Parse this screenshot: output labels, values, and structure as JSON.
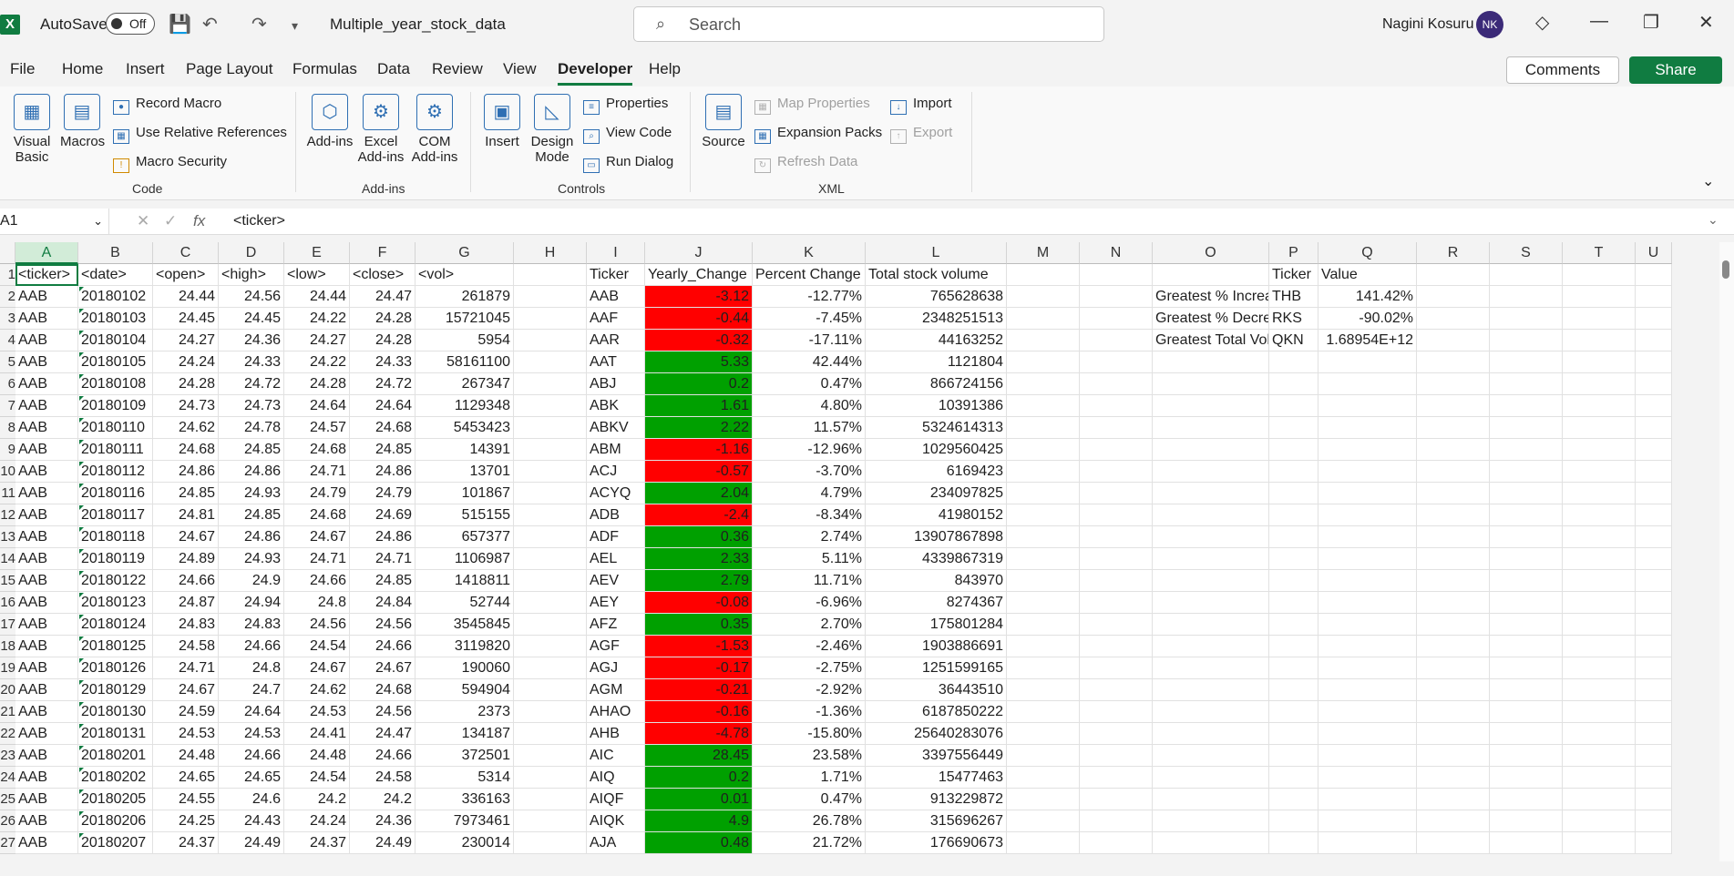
{
  "app": {
    "autosave_label": "AutoSave",
    "autosave_state": "Off",
    "file_title": "Multiple_year_stock_data",
    "search_placeholder": "Search",
    "user_name": "Nagini Kosuru",
    "user_initials": "NK"
  },
  "menu": [
    "File",
    "Home",
    "Insert",
    "Page Layout",
    "Formulas",
    "Data",
    "Review",
    "View",
    "Developer",
    "Help"
  ],
  "menu_active": "Developer",
  "actions": {
    "comments": "Comments",
    "share": "Share"
  },
  "ribbon": {
    "code": {
      "visual_basic": "Visual Basic",
      "macros": "Macros",
      "record_macro": "Record Macro",
      "use_relative": "Use Relative References",
      "macro_security": "Macro Security",
      "group": "Code"
    },
    "addins": {
      "add_ins": "Add-ins",
      "excel_add_ins": "Excel Add-ins",
      "com_add_ins": "COM Add-ins",
      "group": "Add-ins"
    },
    "controls": {
      "insert": "Insert",
      "design_mode": "Design Mode",
      "properties": "Properties",
      "view_code": "View Code",
      "run_dialog": "Run Dialog",
      "group": "Controls"
    },
    "xml": {
      "source": "Source",
      "map_properties": "Map Properties",
      "expansion_packs": "Expansion Packs",
      "refresh_data": "Refresh Data",
      "import": "Import",
      "export": "Export",
      "group": "XML"
    }
  },
  "formula_bar": {
    "name_box": "A1",
    "value": "<ticker>"
  },
  "columns": [
    "A",
    "B",
    "C",
    "D",
    "E",
    "F",
    "G",
    "H",
    "I",
    "J",
    "K",
    "L",
    "M",
    "N",
    "O",
    "P",
    "Q",
    "R",
    "S",
    "T",
    "U"
  ],
  "rows": [
    "1",
    "2",
    "3",
    "4",
    "5",
    "6",
    "7",
    "8",
    "9",
    "10",
    "11",
    "12",
    "13",
    "14",
    "15",
    "16",
    "17",
    "18",
    "19",
    "20",
    "21",
    "22",
    "23",
    "24",
    "25",
    "26",
    "27"
  ],
  "header_row": [
    "<ticker>",
    "<date>",
    "<open>",
    "<high>",
    "<low>",
    "<close>",
    "<vol>",
    "",
    "Ticker",
    "Yearly_Change",
    "Percent Change",
    "Total  stock volume"
  ],
  "stock_rows": [
    [
      "AAB",
      "20180102",
      "24.44",
      "24.56",
      "24.44",
      "24.47",
      "261879"
    ],
    [
      "AAB",
      "20180103",
      "24.45",
      "24.45",
      "24.22",
      "24.28",
      "15721045"
    ],
    [
      "AAB",
      "20180104",
      "24.27",
      "24.36",
      "24.27",
      "24.28",
      "5954"
    ],
    [
      "AAB",
      "20180105",
      "24.24",
      "24.33",
      "24.22",
      "24.33",
      "58161100"
    ],
    [
      "AAB",
      "20180108",
      "24.28",
      "24.72",
      "24.28",
      "24.72",
      "267347"
    ],
    [
      "AAB",
      "20180109",
      "24.73",
      "24.73",
      "24.64",
      "24.64",
      "1129348"
    ],
    [
      "AAB",
      "20180110",
      "24.62",
      "24.78",
      "24.57",
      "24.68",
      "5453423"
    ],
    [
      "AAB",
      "20180111",
      "24.68",
      "24.85",
      "24.68",
      "24.85",
      "14391"
    ],
    [
      "AAB",
      "20180112",
      "24.86",
      "24.86",
      "24.71",
      "24.86",
      "13701"
    ],
    [
      "AAB",
      "20180116",
      "24.85",
      "24.93",
      "24.79",
      "24.79",
      "101867"
    ],
    [
      "AAB",
      "20180117",
      "24.81",
      "24.85",
      "24.68",
      "24.69",
      "515155"
    ],
    [
      "AAB",
      "20180118",
      "24.67",
      "24.86",
      "24.67",
      "24.86",
      "657377"
    ],
    [
      "AAB",
      "20180119",
      "24.89",
      "24.93",
      "24.71",
      "24.71",
      "1106987"
    ],
    [
      "AAB",
      "20180122",
      "24.66",
      "24.9",
      "24.66",
      "24.85",
      "1418811"
    ],
    [
      "AAB",
      "20180123",
      "24.87",
      "24.94",
      "24.8",
      "24.84",
      "52744"
    ],
    [
      "AAB",
      "20180124",
      "24.83",
      "24.83",
      "24.56",
      "24.56",
      "3545845"
    ],
    [
      "AAB",
      "20180125",
      "24.58",
      "24.66",
      "24.54",
      "24.66",
      "3119820"
    ],
    [
      "AAB",
      "20180126",
      "24.71",
      "24.8",
      "24.67",
      "24.67",
      "190060"
    ],
    [
      "AAB",
      "20180129",
      "24.67",
      "24.7",
      "24.62",
      "24.68",
      "594904"
    ],
    [
      "AAB",
      "20180130",
      "24.59",
      "24.64",
      "24.53",
      "24.56",
      "2373"
    ],
    [
      "AAB",
      "20180131",
      "24.53",
      "24.53",
      "24.41",
      "24.47",
      "134187"
    ],
    [
      "AAB",
      "20180201",
      "24.48",
      "24.66",
      "24.48",
      "24.66",
      "372501"
    ],
    [
      "AAB",
      "20180202",
      "24.65",
      "24.65",
      "24.54",
      "24.58",
      "5314"
    ],
    [
      "AAB",
      "20180205",
      "24.55",
      "24.6",
      "24.2",
      "24.2",
      "336163"
    ],
    [
      "AAB",
      "20180206",
      "24.25",
      "24.43",
      "24.24",
      "24.36",
      "7973461"
    ],
    [
      "AAB",
      "20180207",
      "24.37",
      "24.49",
      "24.37",
      "24.49",
      "230014"
    ]
  ],
  "summary_rows": [
    [
      "AAB",
      "-3.12",
      "-12.77%",
      "765628638"
    ],
    [
      "AAF",
      "-0.44",
      "-7.45%",
      "2348251513"
    ],
    [
      "AAR",
      "-0.32",
      "-17.11%",
      "44163252"
    ],
    [
      "AAT",
      "5.33",
      "42.44%",
      "1121804"
    ],
    [
      "ABJ",
      "0.2",
      "0.47%",
      "866724156"
    ],
    [
      "ABK",
      "1.61",
      "4.80%",
      "10391386"
    ],
    [
      "ABKV",
      "2.22",
      "11.57%",
      "5324614313"
    ],
    [
      "ABM",
      "-1.16",
      "-12.96%",
      "1029560425"
    ],
    [
      "ACJ",
      "-0.57",
      "-3.70%",
      "6169423"
    ],
    [
      "ACYQ",
      "2.04",
      "4.79%",
      "234097825"
    ],
    [
      "ADB",
      "-2.4",
      "-8.34%",
      "41980152"
    ],
    [
      "ADF",
      "0.36",
      "2.74%",
      "13907867898"
    ],
    [
      "AEL",
      "2.33",
      "5.11%",
      "4339867319"
    ],
    [
      "AEV",
      "2.79",
      "11.71%",
      "843970"
    ],
    [
      "AEY",
      "-0.08",
      "-6.96%",
      "8274367"
    ],
    [
      "AFZ",
      "0.35",
      "2.70%",
      "175801284"
    ],
    [
      "AGF",
      "-1.53",
      "-2.46%",
      "1903886691"
    ],
    [
      "AGJ",
      "-0.17",
      "-2.75%",
      "1251599165"
    ],
    [
      "AGM",
      "-0.21",
      "-2.92%",
      "36443510"
    ],
    [
      "AHAO",
      "-0.16",
      "-1.36%",
      "6187850222"
    ],
    [
      "AHB",
      "-4.78",
      "-15.80%",
      "25640283076"
    ],
    [
      "AIC",
      "28.45",
      "23.58%",
      "3397556449"
    ],
    [
      "AIQ",
      "0.2",
      "1.71%",
      "15477463"
    ],
    [
      "AIQF",
      "0.01",
      "0.47%",
      "913229872"
    ],
    [
      "AIQK",
      "4.9",
      "26.78%",
      "315696267"
    ],
    [
      "AJA",
      "0.48",
      "21.72%",
      "176690673"
    ]
  ],
  "greatest": {
    "headers": [
      "Ticker",
      "Value"
    ],
    "rows": [
      [
        "Greatest % Increase",
        "THB",
        "141.42%"
      ],
      [
        "Greatest % Decrease",
        "RKS",
        "-90.02%"
      ],
      [
        "Greatest Total Volume",
        "QKN",
        "1.68954E+12"
      ]
    ]
  },
  "colors": {
    "positive": "#00a000",
    "negative": "#ff0000",
    "accent": "#107c41"
  }
}
